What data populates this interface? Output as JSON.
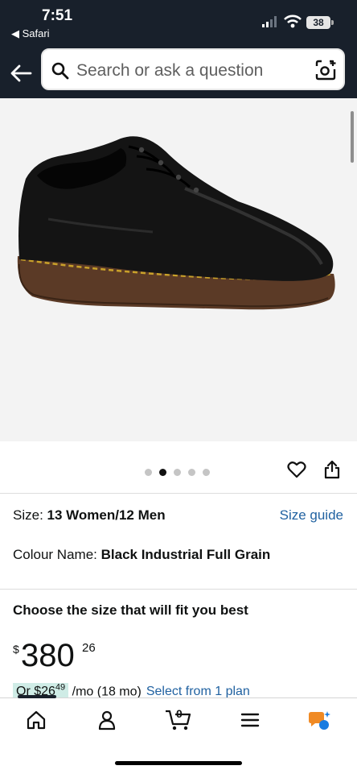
{
  "status_bar": {
    "time": "7:51",
    "back_app": "◀ Safari",
    "battery": "38"
  },
  "search": {
    "placeholder": "Search or ask a question"
  },
  "gallery": {
    "image_count": 5,
    "active_index": 1
  },
  "product": {
    "size_label": "Size: ",
    "size_value": "13 Women/12 Men",
    "size_guide": "Size guide",
    "colour_label": "Colour Name: ",
    "colour_value": "Black Industrial Full Grain",
    "choose_size": "Choose the size that will fit you best",
    "price_symbol": "$",
    "price_whole": "380",
    "price_fraction": "26",
    "plan_or": "Or $26",
    "plan_fraction": "49",
    "plan_term": " /mo (18 mo)",
    "plan_link": "Select from 1 plan"
  },
  "colors": {
    "header_bg": "#18202b",
    "link": "#2162a1",
    "installment_highlight": "#cfece6"
  },
  "bottom_nav": [
    "home-icon",
    "account-icon",
    "cart-icon",
    "menu-icon",
    "assistant-icon"
  ],
  "cart_count": "0"
}
